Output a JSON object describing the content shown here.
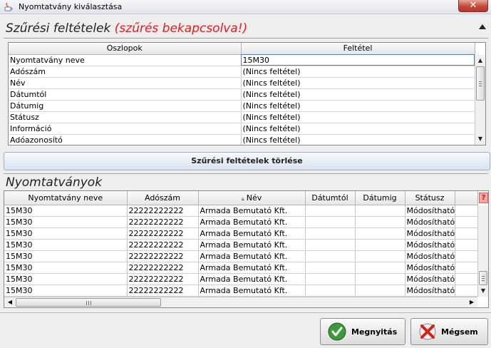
{
  "window": {
    "title": "Nyomtatvány kiválasztása",
    "close_label": "✕"
  },
  "filters": {
    "title": "Szűrési feltételek",
    "status": "(szűrés bekapcsolva!)",
    "columns": {
      "col1": "Oszlopok",
      "col2": "Feltétel"
    },
    "rows": [
      {
        "column": "Nyomtatvány neve",
        "condition": "15M30"
      },
      {
        "column": "Adószám",
        "condition": "(Nincs feltétel)"
      },
      {
        "column": "Név",
        "condition": "(Nincs feltétel)"
      },
      {
        "column": "Dátumtól",
        "condition": "(Nincs feltétel)"
      },
      {
        "column": "Dátumig",
        "condition": "(Nincs feltétel)"
      },
      {
        "column": "Státusz",
        "condition": "(Nincs feltétel)"
      },
      {
        "column": "Információ",
        "condition": "(Nincs feltétel)"
      },
      {
        "column": "Adóazonosító",
        "condition": "(Nincs feltétel)"
      }
    ],
    "clear_button": "Szűrési feltételek törlése"
  },
  "forms": {
    "title": "Nyomtatványok",
    "headers": {
      "name": "Nyomtatvány neve",
      "taxnum": "Adószám",
      "sort_indicator": "▵",
      "person": "Név",
      "from": "Dátumtól",
      "to": "Dátumig",
      "status": "Státusz"
    },
    "help_label": "?",
    "rows": [
      {
        "name": "15M30",
        "taxnum": "22222222222",
        "person": "Armada Bemutató Kft.",
        "from": "",
        "to": "",
        "status": "Módosítható"
      },
      {
        "name": "15M30",
        "taxnum": "22222222222",
        "person": "Armada Bemutató Kft.",
        "from": "",
        "to": "",
        "status": "Módosítható"
      },
      {
        "name": "15M30",
        "taxnum": "22222222222",
        "person": "Armada Bemutató Kft.",
        "from": "",
        "to": "",
        "status": "Módosítható"
      },
      {
        "name": "15M30",
        "taxnum": "22222222222",
        "person": "Armada Bemutató Kft.",
        "from": "",
        "to": "",
        "status": "Módosítható"
      },
      {
        "name": "15M30",
        "taxnum": "22222222222",
        "person": "Armada Bemutató Kft.",
        "from": "",
        "to": "",
        "status": "Módosítható"
      },
      {
        "name": "15M30",
        "taxnum": "22222222222",
        "person": "Armada Bemutató Kft.",
        "from": "",
        "to": "",
        "status": "Módosítható"
      },
      {
        "name": "15M30",
        "taxnum": "22222222222",
        "person": "Armada Bemutató Kft.",
        "from": "",
        "to": "",
        "status": "Módosítható"
      },
      {
        "name": "15M30",
        "taxnum": "22222222222",
        "person": "Armada Bemutató Kft.",
        "from": "",
        "to": "",
        "status": "Módosítható"
      }
    ]
  },
  "buttons": {
    "open": "Megnyitás",
    "cancel": "Mégsem"
  },
  "colors": {
    "filter_status": "#e81a1a",
    "help_bg": "#f4a6a0",
    "open_icon": "#3c9a3c",
    "cancel_icon": "#d2231a"
  }
}
